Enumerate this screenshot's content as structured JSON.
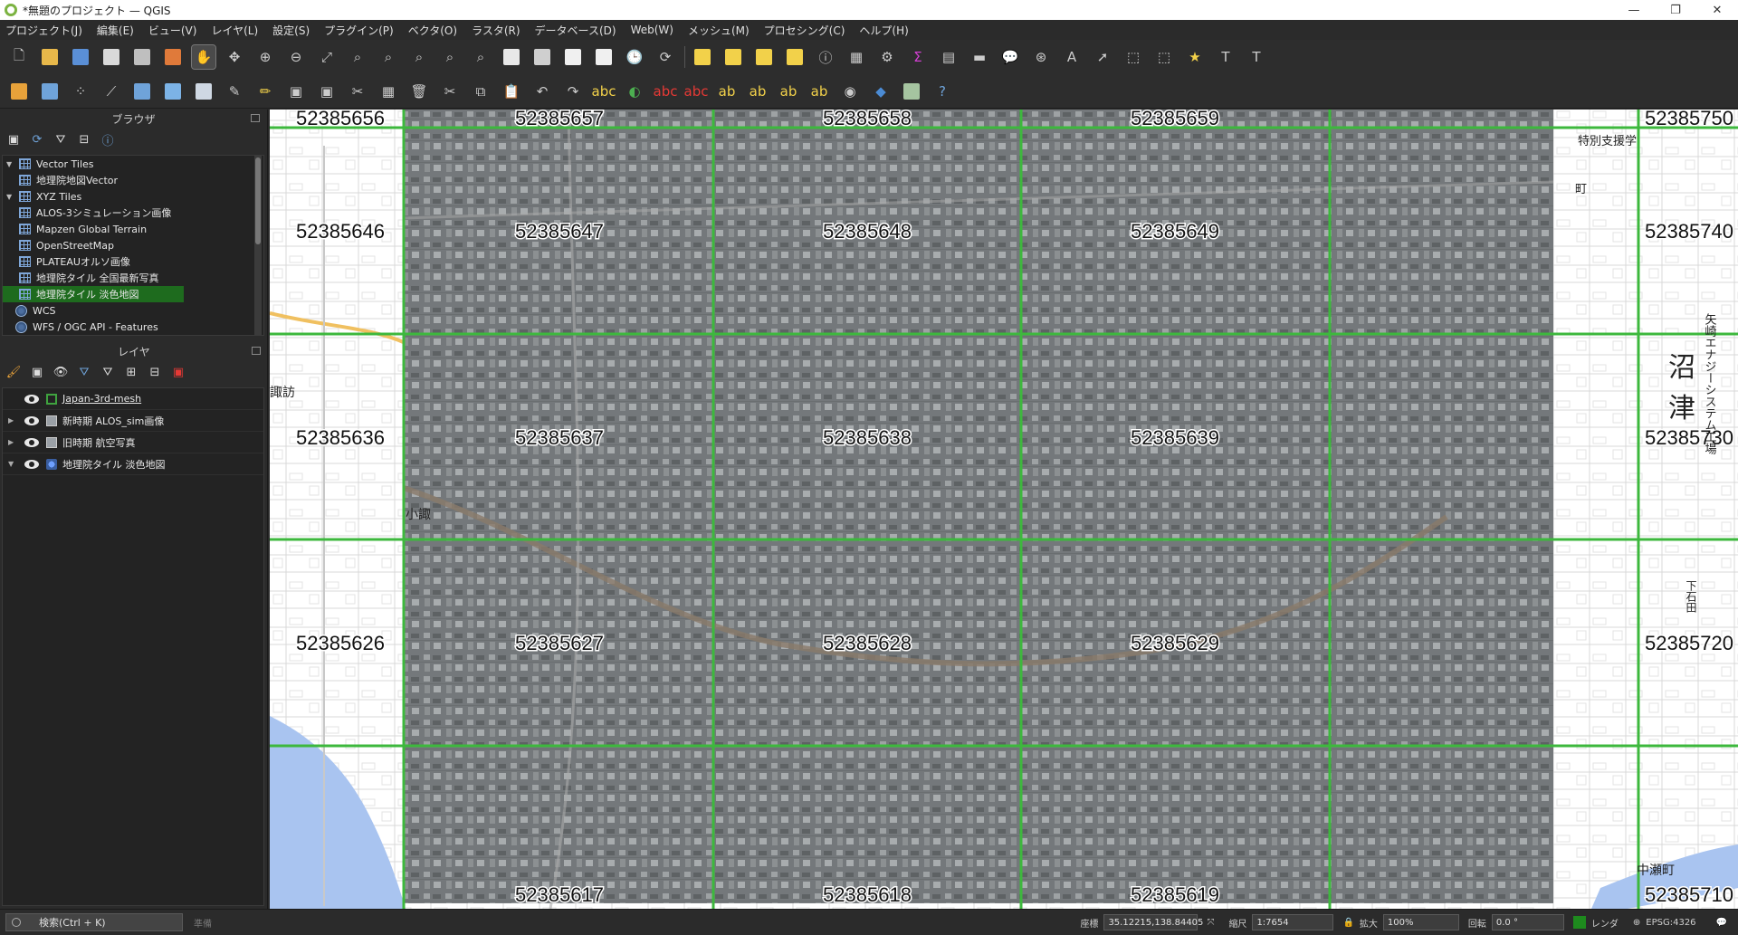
{
  "window": {
    "title": "*無題のプロジェクト — QGIS",
    "controls": [
      "—",
      "❐",
      "✕"
    ]
  },
  "menus": [
    "プロジェクト(J)",
    "編集(E)",
    "ビュー(V)",
    "レイヤ(L)",
    "設定(S)",
    "プラグイン(P)",
    "ベクタ(O)",
    "ラスタ(R)",
    "データベース(D)",
    "Web(W)",
    "メッシュ(M)",
    "プロセシング(C)",
    "ヘルプ(H)"
  ],
  "browser": {
    "title": "ブラウザ",
    "items": [
      {
        "label": "Vector Tiles",
        "level": 0,
        "arrow": "▼",
        "icon": "grid"
      },
      {
        "label": "地理院地図Vector",
        "level": 1,
        "icon": "grid"
      },
      {
        "label": "XYZ Tiles",
        "level": 0,
        "arrow": "▼",
        "icon": "grid"
      },
      {
        "label": "ALOS-3シミュレーション画像",
        "level": 1,
        "icon": "grid"
      },
      {
        "label": "Mapzen Global Terrain",
        "level": 1,
        "icon": "grid"
      },
      {
        "label": "OpenStreetMap",
        "level": 1,
        "icon": "grid"
      },
      {
        "label": "PLATEAUオルソ画像",
        "level": 1,
        "icon": "grid"
      },
      {
        "label": "地理院タイル 全国最新写真",
        "level": 1,
        "icon": "grid"
      },
      {
        "label": "地理院タイル 淡色地図",
        "level": 1,
        "icon": "grid",
        "selected": true
      },
      {
        "label": "WCS",
        "level": 0,
        "icon": "globe"
      },
      {
        "label": "WFS / OGC API - Features",
        "level": 0,
        "icon": "globe"
      }
    ]
  },
  "layers": {
    "title": "レイヤ",
    "items": [
      {
        "label": "Japan-3rd-mesh",
        "symbol": "square",
        "expandable": false,
        "underlined": true
      },
      {
        "label": "新時期 ALOS_sim画像",
        "symbol": "raster",
        "expandable": true,
        "arrow": "▶"
      },
      {
        "label": "旧時期 航空写真",
        "symbol": "raster",
        "expandable": true,
        "arrow": "▶"
      },
      {
        "label": "地理院タイル 淡色地図",
        "symbol": "tile",
        "expandable": true,
        "arrow": "▼"
      }
    ]
  },
  "map": {
    "mesh_codes": [
      [
        "52385656",
        "52385657",
        "52385658",
        "52385659",
        "52385750"
      ],
      [
        "52385646",
        "52385647",
        "52385648",
        "52385649",
        "52385740"
      ],
      [
        "52385636",
        "52385637",
        "52385638",
        "52385639",
        "52385730"
      ],
      [
        "52385626",
        "52385627",
        "52385628",
        "52385629",
        "52385720"
      ],
      [
        "52385617",
        "52385618",
        "52385619",
        "52385710"
      ]
    ],
    "place_labels": [
      "特別支援学",
      "矢崎エナジーシステム工場",
      "沼",
      "津",
      "小諏",
      "諏訪",
      "中瀬町",
      "下石田",
      "町"
    ],
    "colors": {
      "grid": "#3db83d",
      "sea": "#a9c4f0",
      "aerial": "#7a7e80",
      "basemap": "#ffffff"
    }
  },
  "status": {
    "search_placeholder": "検索(Ctrl + K)",
    "hint": "準備",
    "coord_label": "座標",
    "coord_value": "35.12215,138.84405",
    "scale_label": "縮尺",
    "scale_value": "1:7654",
    "magnify_label": "拡大",
    "magnify_value": "100%",
    "rotation_label": "回転",
    "rotation_value": "0.0 °",
    "render_label": "レンダ",
    "crs": "EPSG:4326"
  }
}
